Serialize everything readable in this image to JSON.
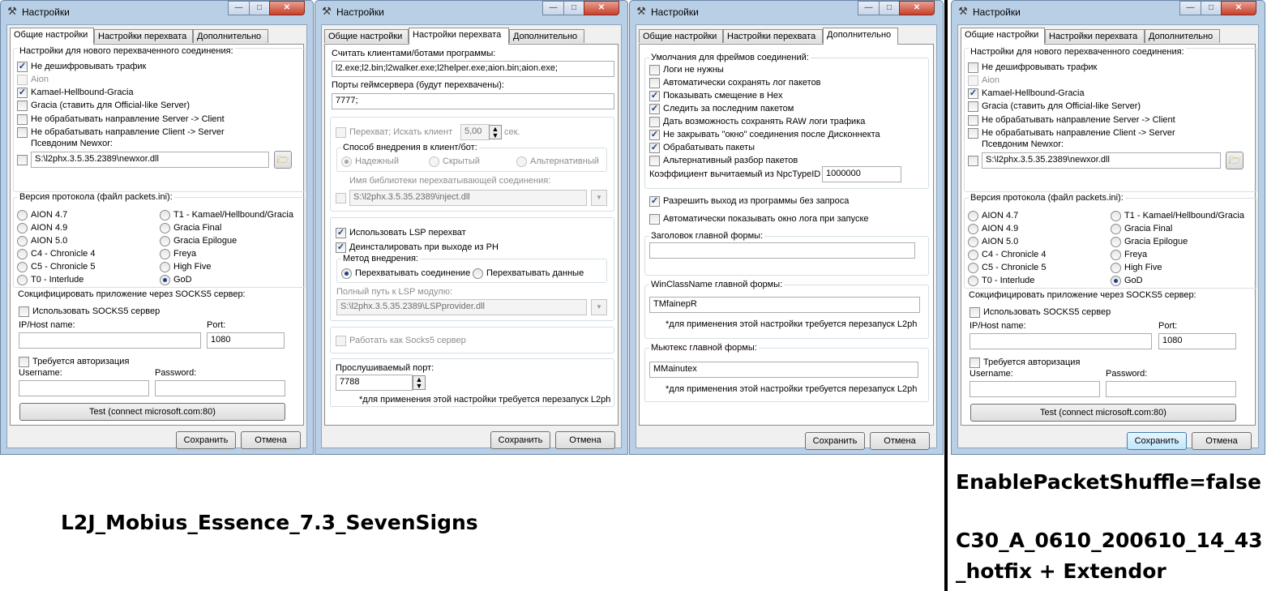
{
  "window": {
    "title": "Настройки",
    "min_glyph": "—",
    "max_glyph": "□",
    "close_glyph": "✕",
    "tool_glyph": "⚒"
  },
  "tabs": {
    "general": "Общие настройки",
    "intercept": "Настройки перехвата",
    "extra": "Дополнительно"
  },
  "buttons": {
    "save": "Сохранить",
    "cancel": "Отмена",
    "test": "Test (connect microsoft.com:80)"
  },
  "general": {
    "group_new_conn": "Настройки для нового перехваченного соединения:",
    "no_decrypt": "Не дешифровывать трафик",
    "aion": "Aion",
    "kamael": "Kamael-Hellbound-Gracia",
    "gracia_official": "Gracia (ставить для Official-like Server)",
    "no_server_client": "Не обрабатывать направление Server -> Client",
    "no_client_server": "Не обрабатывать направление Client -> Server",
    "newxor_label": "Псевдоним Newxor:",
    "newxor_path": "S:\\l2phx.3.5.35.2389\\newxor.dll",
    "folder_glyph": "🗁",
    "group_protocol": "Версия протокола (файл packets.ini):",
    "protocols_left": [
      "AION 4.7",
      "AION 4.9",
      "AION 5.0",
      "C4 - Chronicle 4",
      "C5 - Chronicle 5",
      "T0 - Interlude"
    ],
    "protocols_right": [
      "T1 - Kamael/Hellbound/Gracia",
      "Gracia Final",
      "Gracia Epilogue",
      "Freya",
      "High Five",
      "GoD"
    ],
    "group_socks": "Сокцифицировать приложение через SOCKS5 сервер:",
    "use_socks": "Использовать SOCKS5 сервер",
    "ip_label": "IP/Host name:",
    "port_label": "Port:",
    "port_value": "1080",
    "auth": "Требуется авторизация",
    "username": "Username:",
    "password": "Password:"
  },
  "intercept": {
    "clients_label": "Считать клиентами/ботами программы:",
    "clients_value": "l2.exe;l2.bin;l2walker.exe;l2helper.exe;aion.bin;aion.exe;",
    "ports_label": "Порты геймсервера (будут перехвачены):",
    "ports_value": "7777;",
    "hook_label": "Перехват;  Искать клиент",
    "hook_value": "5,00",
    "sec": "сек.",
    "method_group": "Способ внедрения в клиент/бот:",
    "method_reliable": "Надежный",
    "method_hidden": "Скрытый",
    "method_alt": "Альтернативный",
    "lib_label": "Имя библиотеки перехватывающей соединения:",
    "lib_path": "S:\\l2phx.3.5.35.2389\\inject.dll",
    "use_lsp": "Использовать LSP перехват",
    "uninstall": "Деинсталировать при выходе из PH",
    "inject_method": "Метод внедрения:",
    "intercept_conn": "Перехватывать соединение",
    "intercept_data": "Перехватывать данные",
    "lsp_path_label": "Полный путь к LSP модулю:",
    "lsp_path": "S:\\l2phx.3.5.35.2389\\LSPprovider.dll",
    "socks_server": "Работать как Socks5 сервер",
    "listen_label": "Прослушиваемый порт:",
    "listen_value": "7788",
    "restart_note": "*для применения этой настройки требуется перезапуск L2ph"
  },
  "extra": {
    "defaults_group": "Умолчания для фреймов соединений:",
    "options": [
      {
        "label": "Логи не нужны",
        "checked": false
      },
      {
        "label": "Автоматически сохранять лог пакетов",
        "checked": false
      },
      {
        "label": "Показывать смещение в Hex",
        "checked": true
      },
      {
        "label": "Следить за последним пакетом",
        "checked": true
      },
      {
        "label": "Дать возможность сохранять RAW логи трафика",
        "checked": false
      },
      {
        "label": "Не закрывать \"окно\" соединения после Дисконнекта",
        "checked": true
      },
      {
        "label": "Обрабатывать пакеты",
        "checked": true
      },
      {
        "label": "Альтернативный разбор пакетов",
        "checked": false
      }
    ],
    "npc_label": "Коэффициент вычитаемый из NpcTypeID",
    "npc_value": "1000000",
    "allow_exit": "Разрешить выход из программы без запроса",
    "auto_log": "Автоматически показывать окно лога при запуске",
    "main_title_group": "Заголовок главной формы:",
    "main_title_value": "",
    "winclass_group": "WinClassName главной формы:",
    "winclass_value": "TMfainepR",
    "mutex_group": "Мьютекс главной формы:",
    "mutex_value": "MMainutex",
    "restart_note": "*для применения этой настройки требуется перезапуск L2ph"
  },
  "captions": {
    "left": "L2J_Mobius_Essence_7.3_SevenSigns",
    "right_1": "EnablePacketShuffle=false",
    "right_2": "C30_A_0610_200610_14_43",
    "right_3": "_hotfix + Extendor"
  }
}
